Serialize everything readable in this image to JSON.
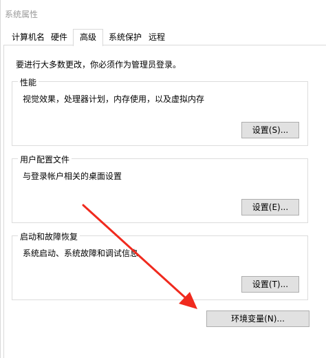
{
  "window": {
    "title": "系统属性"
  },
  "tabs": [
    {
      "label": "计算机名",
      "active": false
    },
    {
      "label": "硬件",
      "active": false
    },
    {
      "label": "高级",
      "active": true
    },
    {
      "label": "系统保护",
      "active": false
    },
    {
      "label": "远程",
      "active": false
    }
  ],
  "notice": "要进行大多数更改，你必须作为管理员登录。",
  "groups": {
    "performance": {
      "title": "性能",
      "description": "视觉效果，处理器计划，内存使用，以及虚拟内存",
      "button": "设置(S)..."
    },
    "user_profiles": {
      "title": "用户配置文件",
      "description": "与登录帐户相关的桌面设置",
      "button": "设置(E)..."
    },
    "startup_recovery": {
      "title": "启动和故障恢复",
      "description": "系统启动、系统故障和调试信息",
      "button": "设置(T)..."
    }
  },
  "env_button": "环境变量(N)...",
  "colors": {
    "annotation_arrow": "#f02a1e",
    "button_face": "#e1e1e1",
    "border": "#d9d9d9"
  }
}
